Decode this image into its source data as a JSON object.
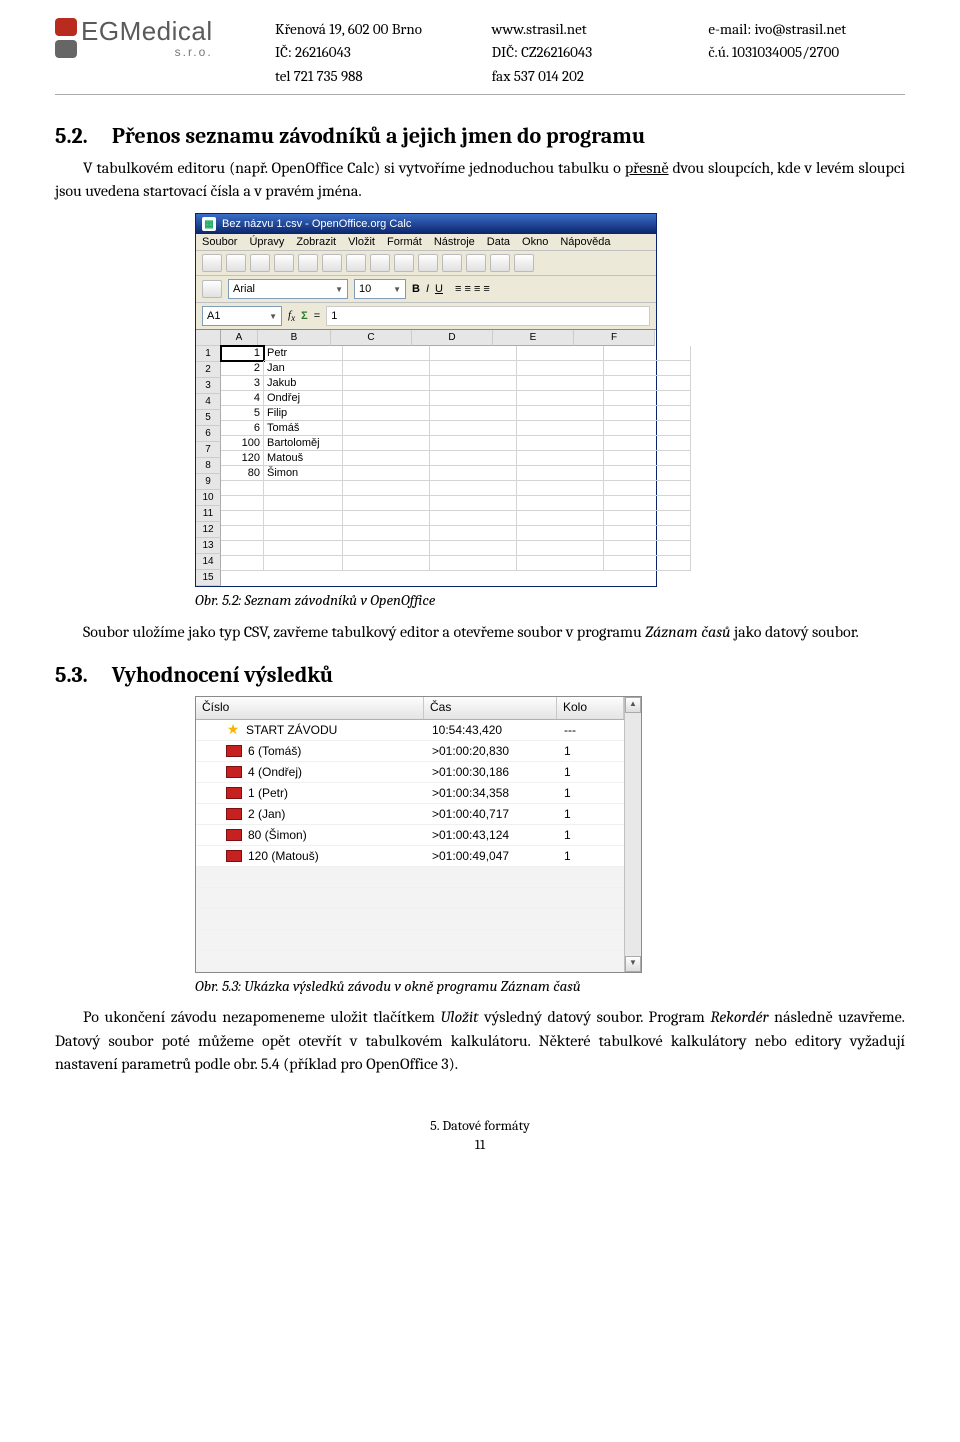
{
  "header": {
    "logo_main": "EGMedical",
    "logo_sub": "s.r.o.",
    "col1": [
      "Křenová 19, 602 00 Brno",
      "IČ: 26216043",
      "tel 721 735 988"
    ],
    "col2": [
      "www.strasil.net",
      "DIČ: CZ26216043",
      "fax 537 014 202"
    ],
    "col3": [
      "e-mail: ivo@strasil.net",
      "č.ú. 1031034005/2700"
    ]
  },
  "s52": {
    "num": "5.2.",
    "title": "Přenos seznamu závodníků a jejich jmen do programu",
    "p1a": "V tabulkovém editoru (např. OpenOffice Calc) si vytvoříme jednoduchou tabulku o ",
    "p1u": "přesně",
    "p1b": " dvou sloupcích, kde v levém sloupci jsou uvedena startovací čísla a v pravém jména."
  },
  "oo": {
    "title": "Bez názvu 1.csv - OpenOffice.org Calc",
    "menu": [
      "Soubor",
      "Úpravy",
      "Zobrazit",
      "Vložit",
      "Formát",
      "Nástroje",
      "Data",
      "Okno",
      "Nápověda"
    ],
    "font": "Arial",
    "size": "10",
    "cellref": "A1",
    "cellval": "1",
    "cols": [
      "A",
      "B",
      "C",
      "D",
      "E",
      "F"
    ],
    "rows": [
      {
        "n": "1",
        "a": "1",
        "b": "Petr"
      },
      {
        "n": "2",
        "a": "2",
        "b": "Jan"
      },
      {
        "n": "3",
        "a": "3",
        "b": "Jakub"
      },
      {
        "n": "4",
        "a": "4",
        "b": "Ondřej"
      },
      {
        "n": "5",
        "a": "5",
        "b": "Filip"
      },
      {
        "n": "6",
        "a": "6",
        "b": "Tomáš"
      },
      {
        "n": "7",
        "a": "100",
        "b": "Bartoloměj"
      },
      {
        "n": "8",
        "a": "120",
        "b": "Matouš"
      },
      {
        "n": "9",
        "a": "80",
        "b": "Šimon"
      },
      {
        "n": "10",
        "a": "",
        "b": ""
      },
      {
        "n": "11",
        "a": "",
        "b": ""
      },
      {
        "n": "12",
        "a": "",
        "b": ""
      },
      {
        "n": "13",
        "a": "",
        "b": ""
      },
      {
        "n": "14",
        "a": "",
        "b": ""
      },
      {
        "n": "15",
        "a": "",
        "b": ""
      }
    ]
  },
  "caption1": "Obr. 5.2: Seznam závodníků v OpenOffice",
  "p_mid_a": "Soubor uložíme jako typ CSV, zavřeme tabulkový editor a otevřeme soubor v programu ",
  "p_mid_i": "Záznam časů",
  "p_mid_b": " jako datový soubor.",
  "s53": {
    "num": "5.3.",
    "title": "Vyhodnocení výsledků"
  },
  "res": {
    "headers": [
      "Číslo",
      "Čas",
      "Kolo"
    ],
    "rows": [
      {
        "icon": "star",
        "label": "START ZÁVODU",
        "time": "10:54:43,420",
        "round": "---"
      },
      {
        "icon": "flag",
        "label": "6 (Tomáš)",
        "time": ">01:00:20,830",
        "round": "1"
      },
      {
        "icon": "flag",
        "label": "4 (Ondřej)",
        "time": ">01:00:30,186",
        "round": "1"
      },
      {
        "icon": "flag",
        "label": "1 (Petr)",
        "time": ">01:00:34,358",
        "round": "1"
      },
      {
        "icon": "flag",
        "label": "2 (Jan)",
        "time": ">01:00:40,717",
        "round": "1"
      },
      {
        "icon": "flag",
        "label": "80 (Šimon)",
        "time": ">01:00:43,124",
        "round": "1"
      },
      {
        "icon": "flag",
        "label": "120 (Matouš)",
        "time": ">01:00:49,047",
        "round": "1"
      }
    ],
    "empty_rows": 5
  },
  "caption2": "Obr. 5.3: Ukázka výsledků závodu v okně programu Záznam časů",
  "p_end_a": "Po ukončení závodu nezapomeneme uložit tlačítkem ",
  "p_end_i1": "Uložit",
  "p_end_b": " výsledný datový soubor. Program ",
  "p_end_i2": "Rekordér",
  "p_end_c": " následně uzavřeme. Datový soubor poté můžeme opět otevřít v tabulkovém kalkulátoru. Některé tabulkové kalkulátory nebo editory vyžadují nastavení parametrů podle obr. 5.4 (příklad pro OpenOffice 3).",
  "footer": {
    "section": "5. Datové formáty",
    "page": "11"
  }
}
